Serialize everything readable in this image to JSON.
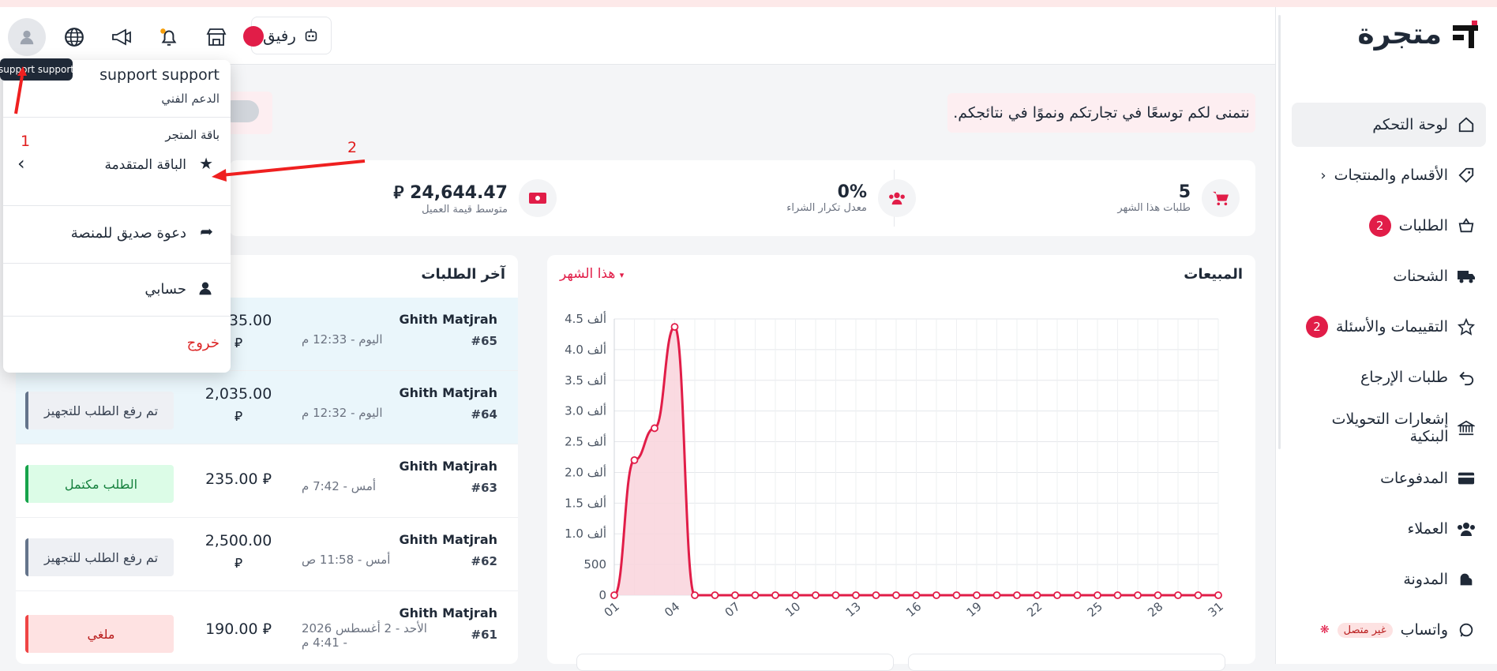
{
  "sidebar": {
    "logo_text": "متجرة",
    "items": [
      {
        "label": "لوحة التحكم",
        "icon": "home-icon",
        "active": true
      },
      {
        "label": "الأقسام والمنتجات",
        "icon": "tag-icon",
        "chevron": true
      },
      {
        "label": "الطلبات",
        "icon": "basket-icon",
        "badge": "2"
      },
      {
        "label": "الشحنات",
        "icon": "truck-icon"
      },
      {
        "label": "التقييمات والأسئلة",
        "icon": "star-icon",
        "badge": "2"
      },
      {
        "label": "طلبات الإرجاع",
        "icon": "return-icon"
      },
      {
        "label": "إشعارات التحويلات البنكية",
        "icon": "bank-icon"
      },
      {
        "label": "المدفوعات",
        "icon": "card-icon"
      },
      {
        "label": "العملاء",
        "icon": "users-icon"
      },
      {
        "label": "المدونة",
        "icon": "blog-icon"
      },
      {
        "label": "واتساب",
        "icon": "whatsapp-icon",
        "status": "غير متصل"
      }
    ]
  },
  "header": {
    "partner_label": "رفيق"
  },
  "welcome": "نتمنى لكم توسعًا في تجارتكم ونموًا في نتائجكم.",
  "stats": [
    {
      "value": "5",
      "label": "طلبات هذا الشهر",
      "icon": "cart-icon"
    },
    {
      "value": "0%",
      "label": "معدل تكرار الشراء",
      "icon": "users-icon"
    },
    {
      "value": "24,644.47",
      "label": "متوسط قيمة العميل",
      "icon": "money-icon"
    }
  ],
  "currency_symbol": "⃁",
  "sales": {
    "title": "المبيعات",
    "range": "هذا الشهر"
  },
  "chart_data": {
    "type": "area",
    "x": [
      "01",
      "02",
      "03",
      "04",
      "05",
      "06",
      "07",
      "08",
      "09",
      "10",
      "11",
      "12",
      "13",
      "14",
      "15",
      "16",
      "17",
      "18",
      "19",
      "20",
      "21",
      "22",
      "23",
      "24",
      "25",
      "26",
      "27",
      "28",
      "29",
      "30",
      "31"
    ],
    "x_tick_labels": [
      "01",
      "04",
      "07",
      "10",
      "13",
      "16",
      "19",
      "22",
      "25",
      "28",
      "31"
    ],
    "y_tick_labels": [
      "0",
      "500",
      "1.0 ألف",
      "1.5 ألف",
      "2.0 ألف",
      "2.5 ألف",
      "3.0 ألف",
      "3.5 ألف",
      "4.0 ألف",
      "4.5 ألف"
    ],
    "values": [
      0,
      2200,
      2720,
      4370,
      0,
      0,
      0,
      0,
      0,
      0,
      0,
      0,
      0,
      0,
      0,
      0,
      0,
      0,
      0,
      0,
      0,
      0,
      0,
      0,
      0,
      0,
      0,
      0,
      0,
      0,
      0
    ],
    "ylim": [
      0,
      4500
    ],
    "grid": true,
    "line_color": "#e11d48",
    "fill_color": "#f9d3dc"
  },
  "orders": {
    "title": "آخر الطلبات",
    "rows": [
      {
        "name": "Ghith Matjrah",
        "id": "#65",
        "date": "اليوم - 12:33 م",
        "amount": "2,035.00",
        "status": ""
      },
      {
        "name": "Ghith Matjrah",
        "id": "#64",
        "date": "اليوم - 12:32 م",
        "amount": "2,035.00",
        "status": "تم رفع الطلب للتجهيز"
      },
      {
        "name": "Ghith Matjrah",
        "id": "#63",
        "date": "أمس - 7:42 م",
        "amount": "235.00",
        "status": "الطلب مكتمل"
      },
      {
        "name": "Ghith Matjrah",
        "id": "#62",
        "date": "أمس - 11:58 ص",
        "amount": "2,500.00",
        "status": "تم رفع الطلب للتجهيز"
      },
      {
        "name": "Ghith Matjrah",
        "id": "#61",
        "date": "الأحد - 2 أغسطس 2026 - 4:41 م",
        "amount": "190.00",
        "status": "ملغي"
      }
    ]
  },
  "dropdown": {
    "user_name": "support support",
    "user_role": "الدعم الفني",
    "package_heading": "باقة المتجر",
    "package_name": "الباقة المتقدمة",
    "invite": "دعوة صديق للمنصة",
    "account": "حسابي",
    "logout": "خروج"
  },
  "tooltip": "support support",
  "annotations": {
    "one": "1",
    "two": "2"
  }
}
